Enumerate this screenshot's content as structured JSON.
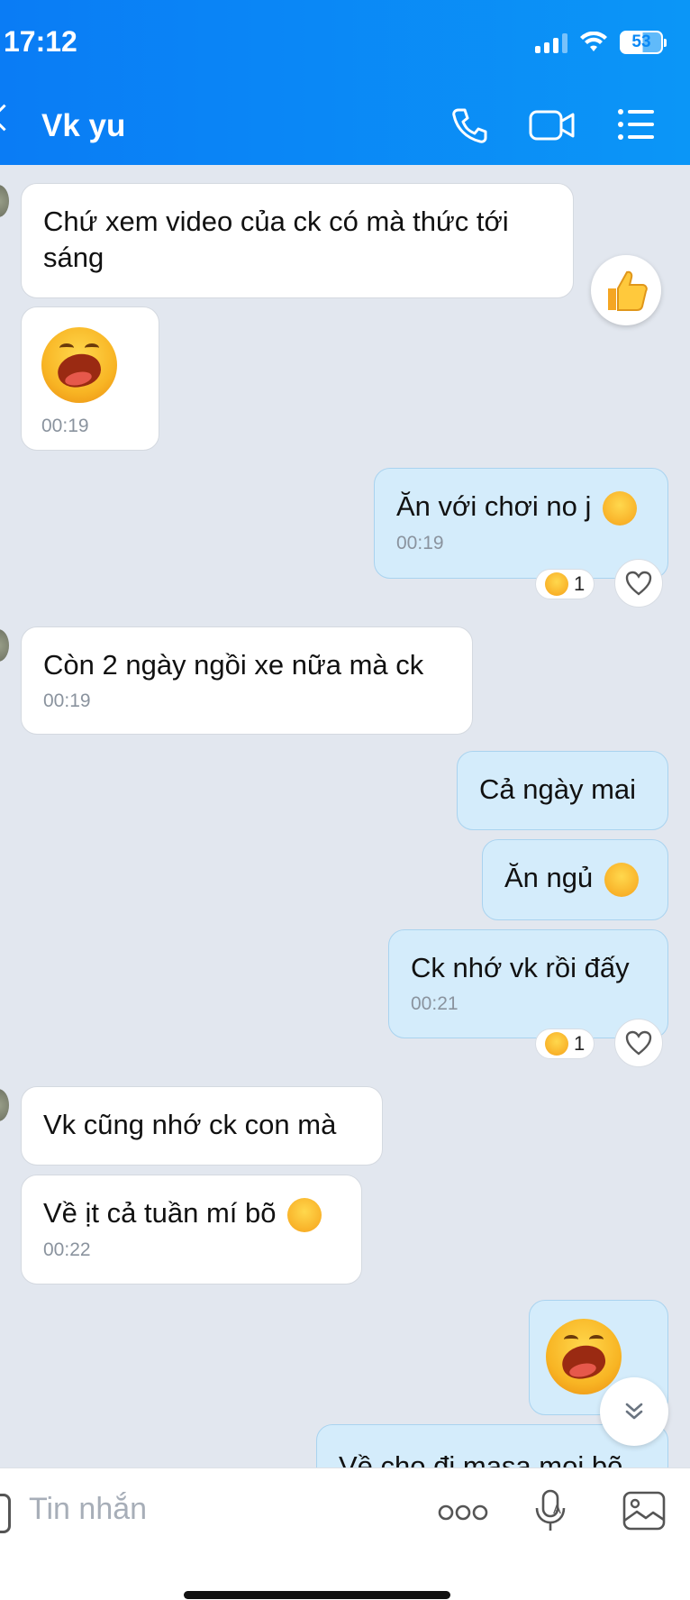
{
  "status_bar": {
    "time": "17:12",
    "battery": "53"
  },
  "header": {
    "title": "Vk yu"
  },
  "messages": [
    {
      "text": "Chứ xem video của ck có mà thức tới sáng"
    },
    {
      "time": "00:19"
    },
    {
      "text": "Ăn với chơi no j",
      "time": "00:19",
      "reaction_count": "1"
    },
    {
      "text": "Còn 2 ngày ngồi xe nữa mà ck",
      "time": "00:19"
    },
    {
      "text": "Cả ngày mai"
    },
    {
      "text": "Ăn ngủ"
    },
    {
      "text": "Ck nhớ vk rồi đấy",
      "time": "00:21",
      "reaction_count": "1"
    },
    {
      "text": "Vk cũng nhớ ck con mà"
    },
    {
      "text": "Về ịt cả tuần mí bõ",
      "time": "00:22"
    },
    {
      "text": ""
    },
    {
      "text": "Về cho đi masa mọi bõ"
    }
  ],
  "composer": {
    "placeholder": "Tin nhắn"
  },
  "colors": {
    "header": "#0a84f5",
    "bg": "#e2e7ef",
    "outgoing": "#d4ecfb",
    "incoming": "#ffffff"
  }
}
